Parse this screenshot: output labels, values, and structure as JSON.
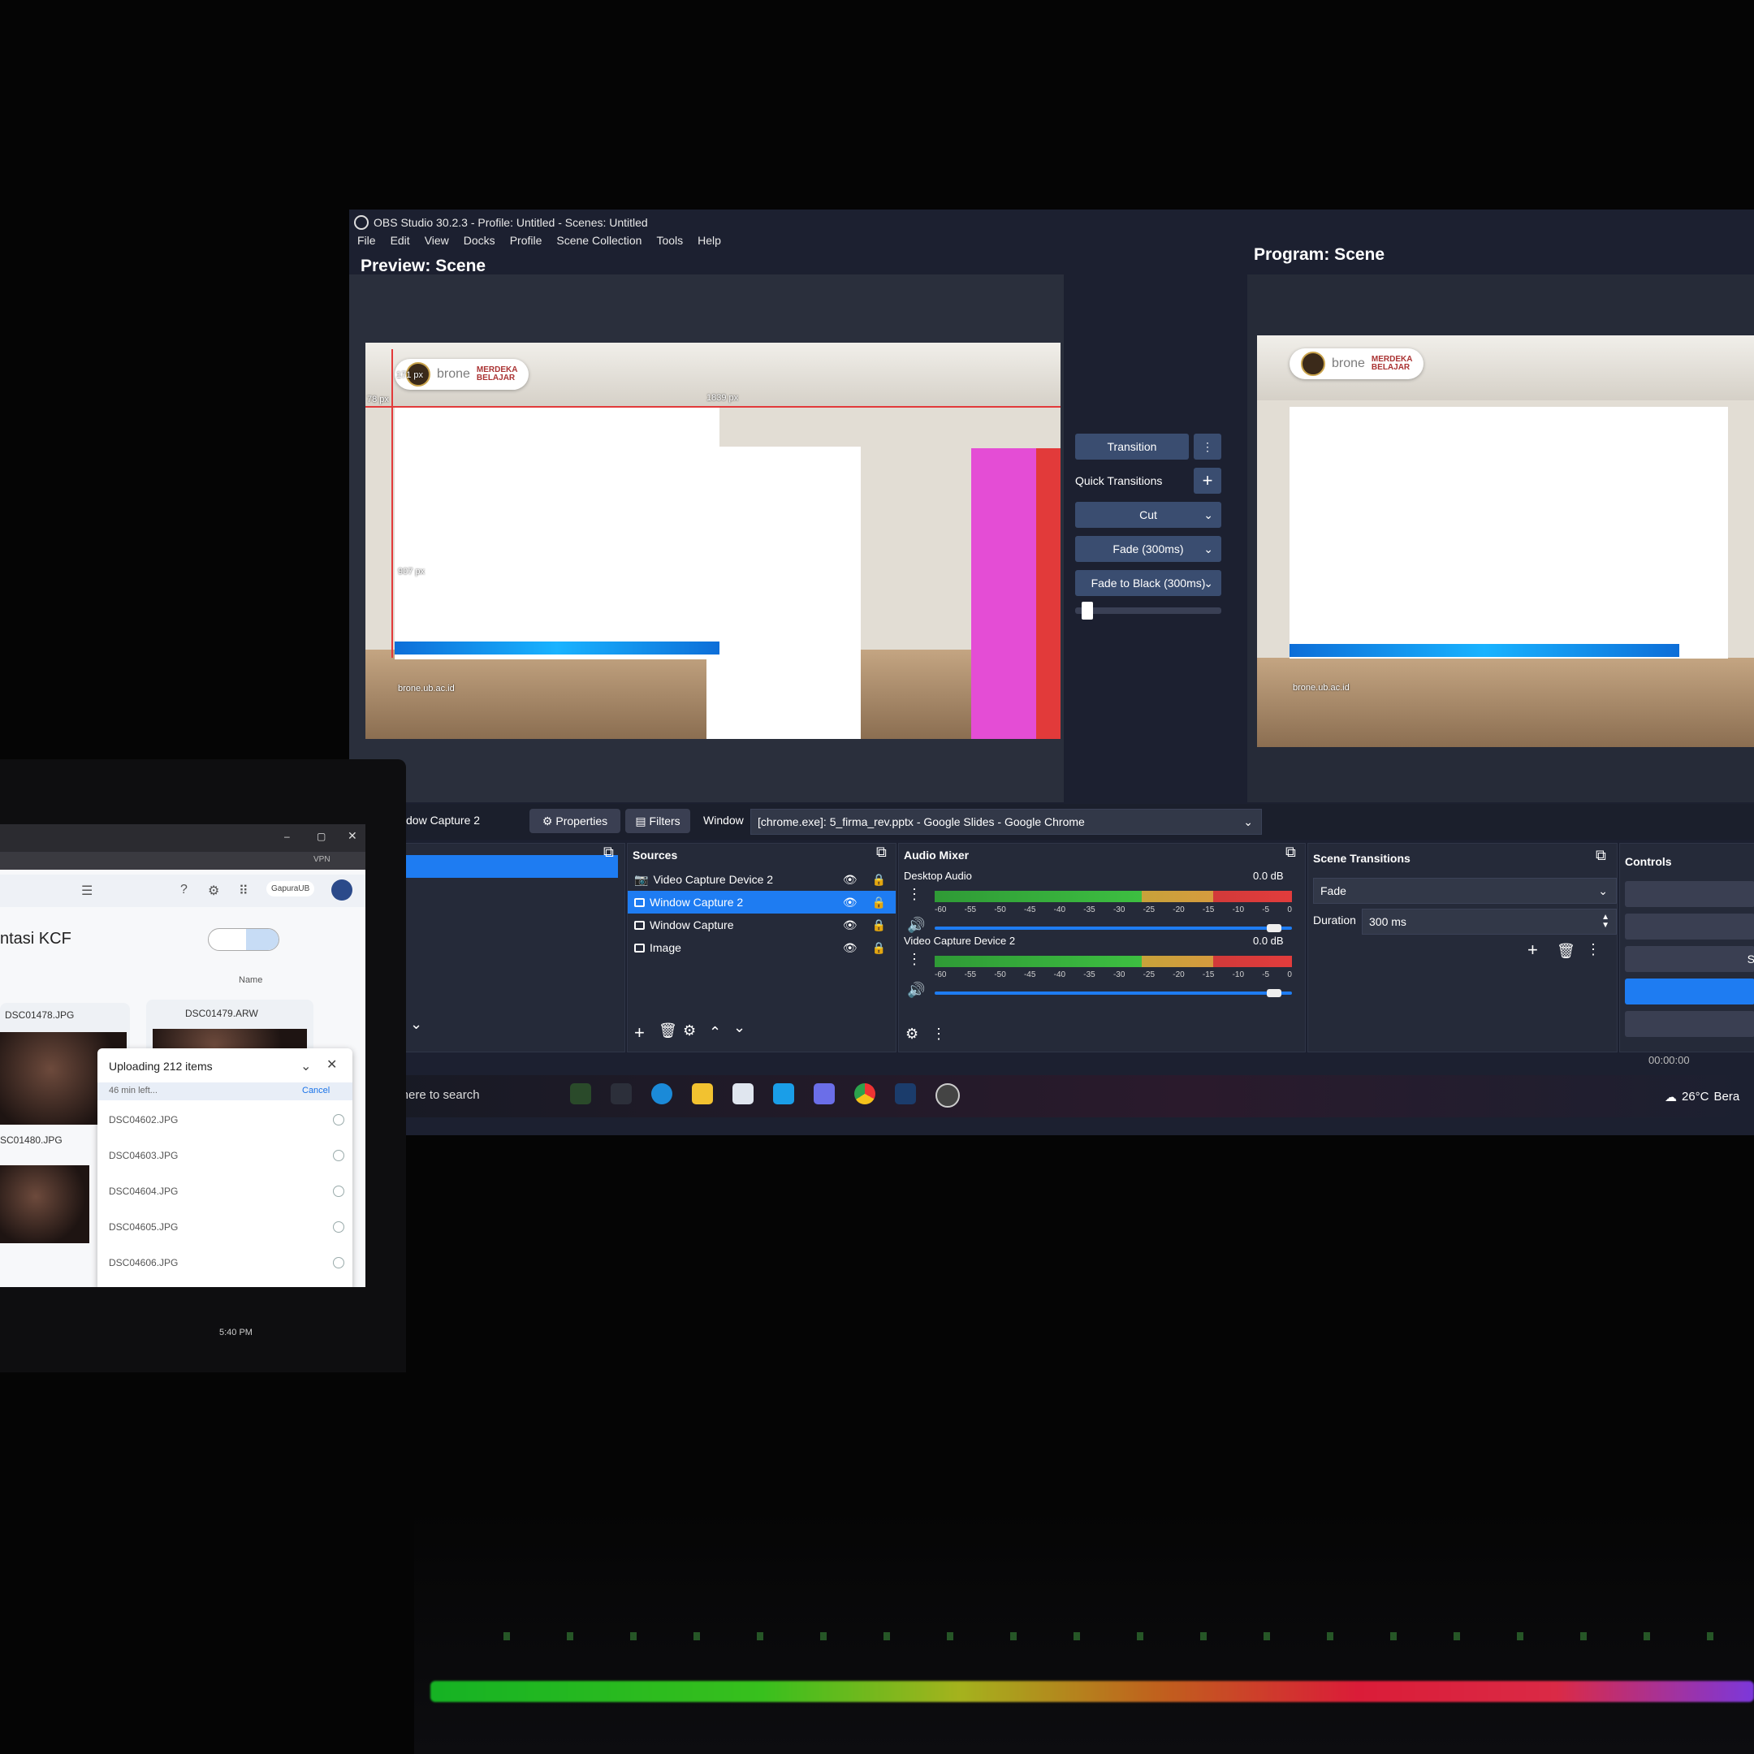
{
  "obs": {
    "title": "OBS Studio 30.2.3 - Profile: Untitled - Scenes: Untitled",
    "menu": [
      "File",
      "Edit",
      "View",
      "Docks",
      "Profile",
      "Scene Collection",
      "Tools",
      "Help"
    ],
    "preview_title": "Preview: Scene",
    "program_title": "Program: Scene",
    "guides": {
      "left": "171 px",
      "top": "78 px",
      "right": "1839 px",
      "bottom": "907 px"
    },
    "watermark": "brone.ub.ac.id",
    "logo_text": "brone",
    "logo_merdeka": "MERDEKA",
    "logo_belajar": "BELAJAR",
    "transition": {
      "transition_label": "Transition",
      "quick_transitions_label": "Quick Transitions",
      "quick_items": [
        "Cut",
        "Fade (300ms)",
        "Fade to Black (300ms)"
      ],
      "tbar_level": 0.05
    },
    "toolbar": {
      "source_name": "dow Capture 2",
      "properties_label": "Properties",
      "filters_label": "Filters",
      "window_label": "Window",
      "window_value": "[chrome.exe]: 5_firma_rev.pptx - Google Slides - Google Chrome"
    },
    "sources": {
      "title": "Sources",
      "items": [
        {
          "name": "Video Capture Device 2",
          "icon": "camera-icon",
          "selected": false
        },
        {
          "name": "Window Capture 2",
          "icon": "window-icon",
          "selected": true
        },
        {
          "name": "Window Capture",
          "icon": "window-icon",
          "selected": false
        },
        {
          "name": "Image",
          "icon": "image-icon",
          "selected": false
        }
      ]
    },
    "mixer": {
      "title": "Audio Mixer",
      "channels": [
        {
          "name": "Desktop Audio",
          "db": "0.0 dB",
          "level": 0.97
        },
        {
          "name": "Video Capture Device 2",
          "db": "0.0 dB",
          "level": 0.97
        }
      ],
      "ticks": [
        "-60",
        "-55",
        "-50",
        "-45",
        "-40",
        "-35",
        "-30",
        "-25",
        "-20",
        "-15",
        "-10",
        "-5",
        "0"
      ]
    },
    "scene_transitions": {
      "title": "Scene Transitions",
      "selected": "Fade",
      "duration_label": "Duration",
      "duration_value": "300 ms"
    },
    "controls": {
      "title": "Controls",
      "partial_label": "S"
    },
    "status": {
      "time": "00:00:00"
    }
  },
  "taskbar": {
    "search_placeholder": "Type here to search",
    "weather": "26°C",
    "weather_partial": "Bera"
  },
  "laptop": {
    "drive_title": "ntasi KCF",
    "sort_label": "Name",
    "account_label": "GapuraUB",
    "vpn_label": "VPN",
    "files": [
      "DSC01478.JPG",
      "DSC01479.ARW",
      "SC01480.JPG"
    ],
    "upload": {
      "title": "Uploading 212 items",
      "time_left": "46 min left...",
      "cancel": "Cancel",
      "items": [
        "DSC04602.JPG",
        "DSC04603.JPG",
        "DSC04604.JPG",
        "DSC04605.JPG",
        "DSC04606.JPG"
      ]
    },
    "clock": "5:40 PM"
  },
  "colors": {
    "accent": "#1e7cf2",
    "panel": "#252a39",
    "magenta": "#e44dd5",
    "red": "#e23a3a"
  }
}
